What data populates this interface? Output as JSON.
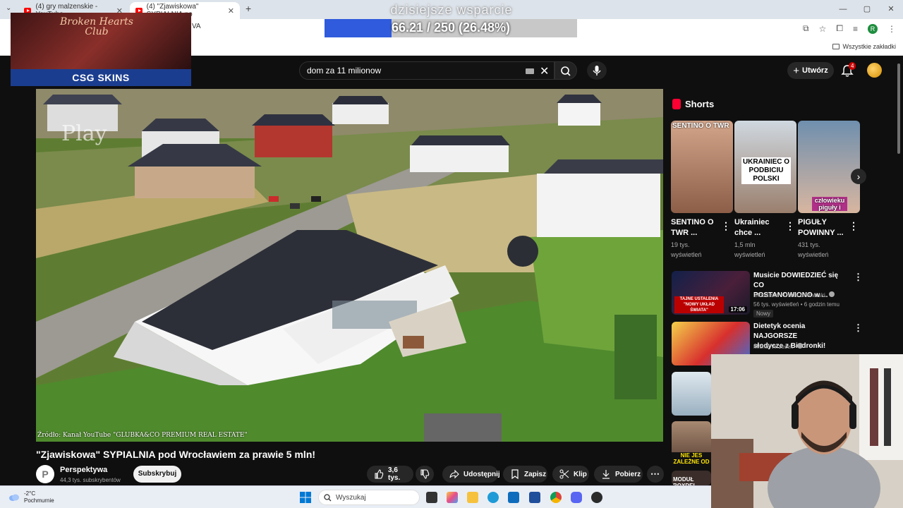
{
  "browser": {
    "tabs": [
      {
        "title": "(4) gry malzenskie - YouTube"
      },
      {
        "title": "(4) \"Zjawiskowa\" SYPIALNIA po"
      }
    ],
    "url_fragment": "VA",
    "bookmarks_label": "Wszystkie zakładki",
    "profile_initial": "R"
  },
  "overlay": {
    "donation_title": "dzisiejsze wsparcie",
    "donation_text": "66.21 / 250 (26.48%)",
    "donation_progress": 0.2648,
    "promo_title_line1": "Broken Hearts",
    "promo_title_line2": "Club",
    "promo_brand": "CSG SKINS",
    "play_text": "Play"
  },
  "youtube": {
    "search_value": "dom za 11 milionow",
    "create_label": "Utwórz",
    "notifications_count": "4",
    "video": {
      "title": "\"Zjawiskowa\" SYPIALNIA pod Wrocławiem za prawie 5 mln!",
      "source_caption": "Źródło: Kanał YouTube \"GLUBKA&CO PREMIUM REAL ESTATE\"",
      "channel_initial": "P",
      "channel_name": "Perspektywa",
      "channel_subs": "44,3 tys. subskrybentów",
      "subscribe_label": "Subskrybuj",
      "likes": "3,6 tys.",
      "share_label": "Udostępnij",
      "save_label": "Zapisz",
      "clip_label": "Klip",
      "download_label": "Pobierz"
    },
    "shorts_heading": "Shorts",
    "shorts": [
      {
        "caption": "SENTINO O TWR",
        "title_line1": "SENTINO O",
        "title_line2": "TWR ...",
        "views_line1": "19 tys.",
        "views_line2": "wyświetleń"
      },
      {
        "caption": "UKRAINIEC O PODBICIU POLSKI",
        "title_line1": "Ukrainiec",
        "title_line2": "chce ...",
        "views_line1": "1,5 mln",
        "views_line2": "wyświetleń"
      },
      {
        "caption": "człowieku piguły i",
        "title_line1": "PIGUŁY",
        "title_line2": "POWINNY ...",
        "views_line1": "431 tys.",
        "views_line2": "wyświetleń"
      }
    ],
    "recommendations": [
      {
        "title_line1": "Musicie DOWIEDZIEĆ się CO",
        "title_line2": "POSTANOWIONO w ...",
        "channel": "Globalista - Oskar Bednarski",
        "meta": "56 tys. wyświetleń • 6 godzin temu",
        "badge": "Nowy",
        "duration": "17:06",
        "thumb_text": "TAJNE USTALENIA \"NOWY UKŁAD ŚWIATA\""
      },
      {
        "title_line1": "Dietetyk ocenia NAJGORSZE",
        "title_line2": "słodycze z Biedronki!",
        "channel": "Michał Wrzosek"
      },
      {
        "thumb_text": "NIE JES ZALEŻNE OD NA"
      },
      {
        "thumb_text": "MODUŁ BOXDEL"
      }
    ]
  },
  "taskbar": {
    "temperature": "-2°C",
    "weather_desc": "Pochmurnie",
    "search_placeholder": "Wyszukaj"
  }
}
